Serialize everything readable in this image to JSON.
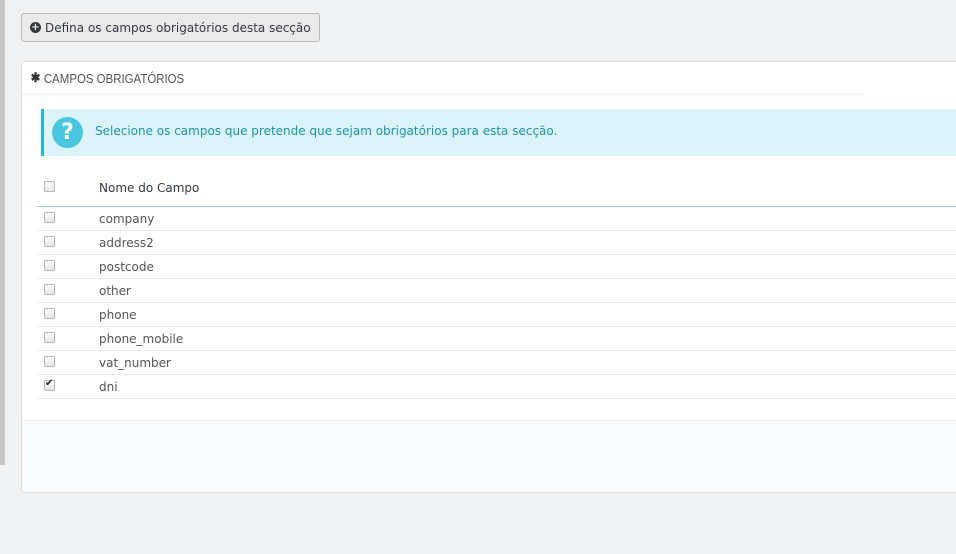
{
  "toolbar": {
    "toggle_label": "Defina os campos obrigatórios desta secção",
    "toggle_icon": "plus-circle-icon"
  },
  "panel": {
    "heading_icon": "asterisk-icon",
    "heading": "CAMPOS OBRIGATÓRIOS",
    "help_icon": "question-circle-icon",
    "info_text": "Selecione os campos que pretende que sejam obrigatórios para esta secção.",
    "table": {
      "column_header": "Nome do Campo",
      "select_all_checked": false,
      "rows": [
        {
          "name": "company",
          "checked": false
        },
        {
          "name": "address2",
          "checked": false
        },
        {
          "name": "postcode",
          "checked": false
        },
        {
          "name": "other",
          "checked": false
        },
        {
          "name": "phone",
          "checked": false
        },
        {
          "name": "phone_mobile",
          "checked": false
        },
        {
          "name": "vat_number",
          "checked": false
        },
        {
          "name": "dni",
          "checked": true
        }
      ]
    }
  },
  "colors": {
    "page_background": "#eff1f2",
    "info_background": "#dcf4f9",
    "info_accent": "#25b9d7",
    "info_text": "#1e94ab"
  }
}
